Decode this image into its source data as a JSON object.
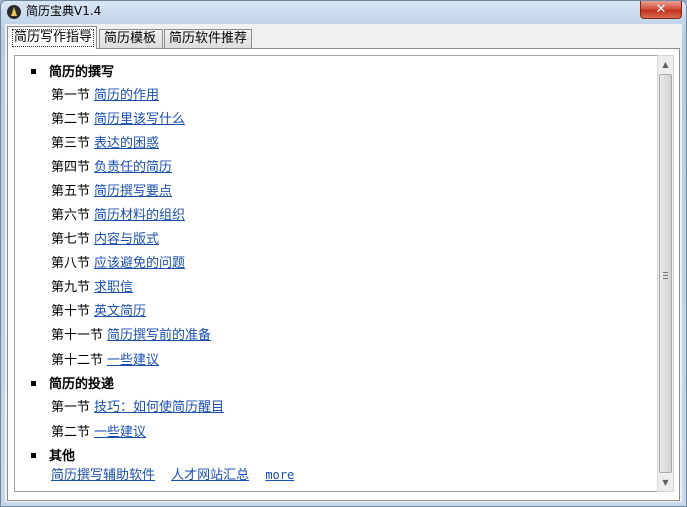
{
  "window": {
    "title": "简历宝典V1.4",
    "close_glyph": "✕",
    "icon": "app-icon"
  },
  "tabs": [
    {
      "label": "简历写作指导",
      "active": true
    },
    {
      "label": "简历模板",
      "active": false
    },
    {
      "label": "简历软件推荐",
      "active": false
    }
  ],
  "sections": [
    {
      "title": "简历的撰写",
      "items": [
        {
          "prefix": "第一节",
          "link": "简历的作用"
        },
        {
          "prefix": "第二节",
          "link": "简历里该写什么"
        },
        {
          "prefix": "第三节",
          "link": "表达的困惑"
        },
        {
          "prefix": "第四节",
          "link": "负责任的简历"
        },
        {
          "prefix": "第五节",
          "link": "简历撰写要点"
        },
        {
          "prefix": "第六节",
          "link": "简历材料的组织"
        },
        {
          "prefix": "第七节",
          "link": "内容与版式"
        },
        {
          "prefix": "第八节",
          "link": "应该避免的问题"
        },
        {
          "prefix": "第九节",
          "link": "求职信"
        },
        {
          "prefix": "第十节",
          "link": "英文简历"
        },
        {
          "prefix": "第十一节",
          "link": "简历撰写前的准备"
        },
        {
          "prefix": "第十二节",
          "link": "一些建议"
        }
      ]
    },
    {
      "title": "简历的投递",
      "items": [
        {
          "prefix": "第一节",
          "link": "技巧：如何使简历醒目"
        },
        {
          "prefix": "第二节",
          "link": "一些建议"
        }
      ]
    },
    {
      "title": "其他",
      "items": []
    }
  ],
  "footer_links": [
    "简历撰写辅助软件",
    "人才网站汇总",
    "more"
  ],
  "colors": {
    "link": "#1a4fae",
    "close_button": "#c1321b",
    "frame": "#b7cbe3"
  }
}
